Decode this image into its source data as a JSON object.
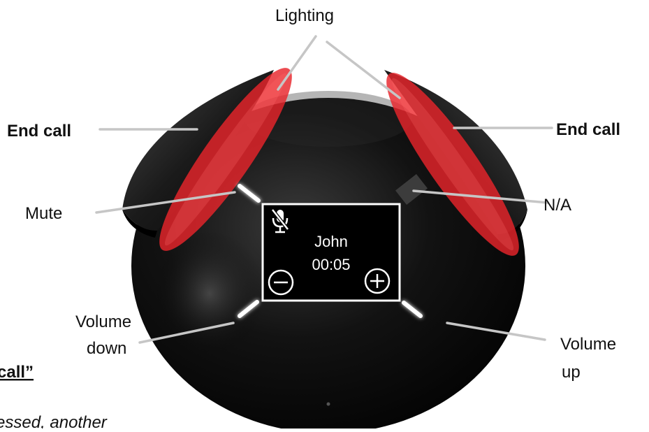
{
  "labels": {
    "lighting": "Lighting",
    "end_call_left": "End call",
    "end_call_right": "End call",
    "mute": "Mute",
    "na": "N/A",
    "volume_down_line1": "Volume",
    "volume_down_line2": "down",
    "volume_up_line1": "Volume",
    "volume_up_line2": "up"
  },
  "screen": {
    "caller_name": "John",
    "call_timer": "00:05"
  },
  "fragments": {
    "left_partial_heading": "call”",
    "left_partial_italic": "essed, another"
  },
  "icons": {
    "mute": "mic-off-icon",
    "volume_down": "minus-circle-icon",
    "volume_up": "plus-circle-icon"
  },
  "colors": {
    "device_body": "#0b0b0b",
    "lighting_red": "#e8242b",
    "leader_line": "#c6c6c6",
    "screen_border": "#ffffff"
  }
}
